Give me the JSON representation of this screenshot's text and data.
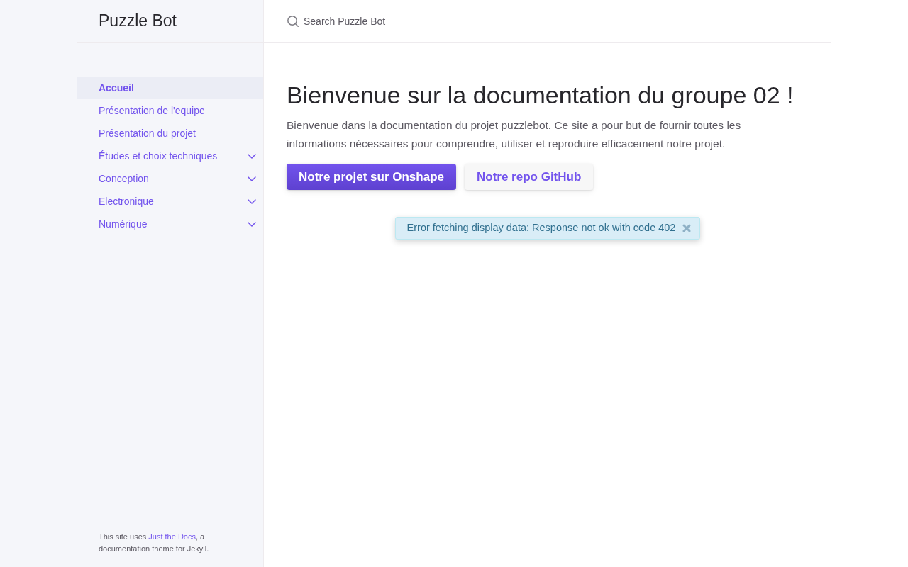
{
  "site_title": "Puzzle Bot",
  "search": {
    "placeholder": "Search Puzzle Bot"
  },
  "nav": [
    {
      "label": "Accueil",
      "selected": true,
      "expandable": false
    },
    {
      "label": "Présentation de l'equipe",
      "selected": false,
      "expandable": false
    },
    {
      "label": "Présentation du projet",
      "selected": false,
      "expandable": false
    },
    {
      "label": "Études et choix techniques",
      "selected": false,
      "expandable": true
    },
    {
      "label": "Conception",
      "selected": false,
      "expandable": true
    },
    {
      "label": "Electronique",
      "selected": false,
      "expandable": true
    },
    {
      "label": "Numérique",
      "selected": false,
      "expandable": true
    }
  ],
  "footer": {
    "before": "This site uses ",
    "link": "Just the Docs",
    "after": ", a documentation theme for Jekyll."
  },
  "page": {
    "title": "Bienvenue sur la documentation du groupe 02 !",
    "intro": "Bienvenue dans la documentation du projet puzzlebot. Ce site a pour but de fournir toutes les informations nécessaires pour comprendre, utiliser et reproduire efficacement notre projet.",
    "buttons": [
      {
        "label": "Notre projet sur Onshape",
        "kind": "primary"
      },
      {
        "label": "Notre repo GitHub",
        "kind": "secondary"
      }
    ]
  },
  "alert": {
    "message": "Error fetching display data: Response not ok with code 402"
  }
}
